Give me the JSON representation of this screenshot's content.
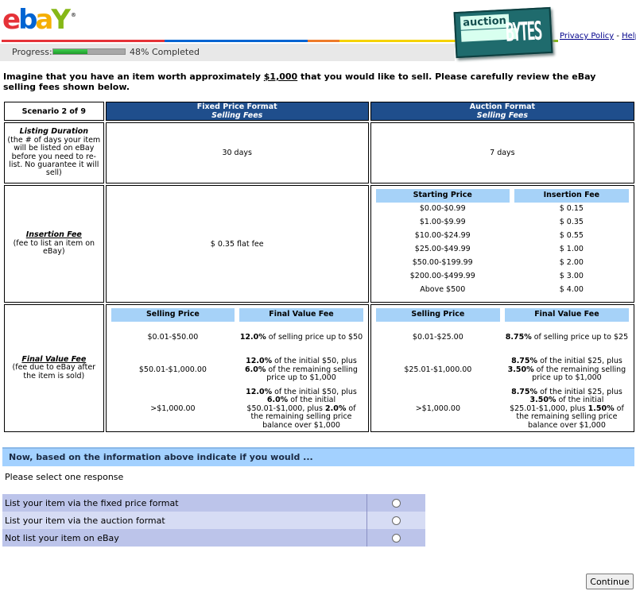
{
  "header": {
    "ebay_logo": {
      "e": "e",
      "b": "b",
      "a": "a",
      "y": "Y",
      "registered": "®"
    },
    "progress": {
      "label": "Progress:",
      "percent": 48,
      "text": "48% Completed"
    },
    "auctionbytes_logo": {
      "top": "auction",
      "big": "BYTES"
    },
    "links": {
      "privacy": "Privacy Policy",
      "separator": " - ",
      "help": "Help"
    },
    "brand_colors": [
      "#e53238",
      "#0064d2",
      "#f5af02",
      "#86b817"
    ]
  },
  "intro": {
    "before": "Imagine that you have an item worth approximately ",
    "amount": "$1,000",
    "after": " that you would like to sell. Please carefully review the eBay selling fees shown below."
  },
  "table": {
    "scenario": "Scenario 2 of 9",
    "fixed_header": {
      "title": "Fixed Price Format",
      "subtitle": "Selling Fees"
    },
    "auction_header": {
      "title": "Auction Format",
      "subtitle": "Selling Fees"
    },
    "listing_duration": {
      "label_title": "Listing Duration",
      "label_desc": "(the # of days your item will be listed on eBay before you need to re-list. No guarantee it will sell)",
      "fixed": "30 days",
      "auction": "7 days"
    },
    "insertion_fee": {
      "label_title": "Insertion Fee",
      "label_desc": "(fee to list an item on eBay)",
      "fixed": "$ 0.35 flat fee",
      "auction_headers": [
        "Starting Price",
        "Insertion Fee"
      ],
      "auction_rows": [
        [
          "$0.00-$0.99",
          "$ 0.15"
        ],
        [
          "$1.00-$9.99",
          "$ 0.35"
        ],
        [
          "$10.00-$24.99",
          "$ 0.55"
        ],
        [
          "$25.00-$49.99",
          "$ 1.00"
        ],
        [
          "$50.00-$199.99",
          "$ 2.00"
        ],
        [
          "$200.00-$499.99",
          "$ 3.00"
        ],
        [
          "Above $500",
          "$ 4.00"
        ]
      ]
    },
    "final_value_fee": {
      "label_title": "Final Value Fee",
      "label_desc": "(fee due to eBay after the item is sold)",
      "headers": [
        "Selling Price",
        "Final Value Fee"
      ],
      "fixed": {
        "r1": {
          "price": "$0.01-$50.00",
          "b1": "12.0%",
          "t1": " of selling price up to $50"
        },
        "r2": {
          "price": "$50.01-$1,000.00",
          "b1": "12.0%",
          "t1": " of the initial $50, plus ",
          "b2": "6.0%",
          "t2": " of the remaining selling price up to $1,000"
        },
        "r3": {
          "price": ">$1,000.00",
          "b1": "12.0%",
          "t1": " of the initial $50, plus ",
          "b2": "6.0%",
          "t2": " of the initial $50.01-$1,000, plus ",
          "b3": "2.0%",
          "t3": " of the remaining selling price balance over $1,000"
        }
      },
      "auction": {
        "r1": {
          "price": "$0.01-$25.00",
          "b1": "8.75%",
          "t1": " of selling price up to $25"
        },
        "r2": {
          "price": "$25.01-$1,000.00",
          "b1": "8.75%",
          "t1": " of the initial $25, plus ",
          "b2": "3.50%",
          "t2": " of the remaining selling price up to $1,000"
        },
        "r3": {
          "price": ">$1,000.00",
          "b1": "8.75%",
          "t1": " of the initial $25, plus ",
          "b2": "3.50%",
          "t2": " of the initial $25.01-$1,000, plus ",
          "b3": "1.50%",
          "t3": " of the remaining selling price balance over $1,000"
        }
      }
    }
  },
  "question": {
    "prompt": "Now, based on the information above indicate if you would ...",
    "instruction": "Please select one response",
    "options": [
      {
        "label": "List your item via the fixed price format",
        "selected": false
      },
      {
        "label": "List your item via the auction format",
        "selected": false
      },
      {
        "label": "Not list your item on eBay",
        "selected": false
      }
    ]
  },
  "footer": {
    "continue_label": "Continue"
  }
}
